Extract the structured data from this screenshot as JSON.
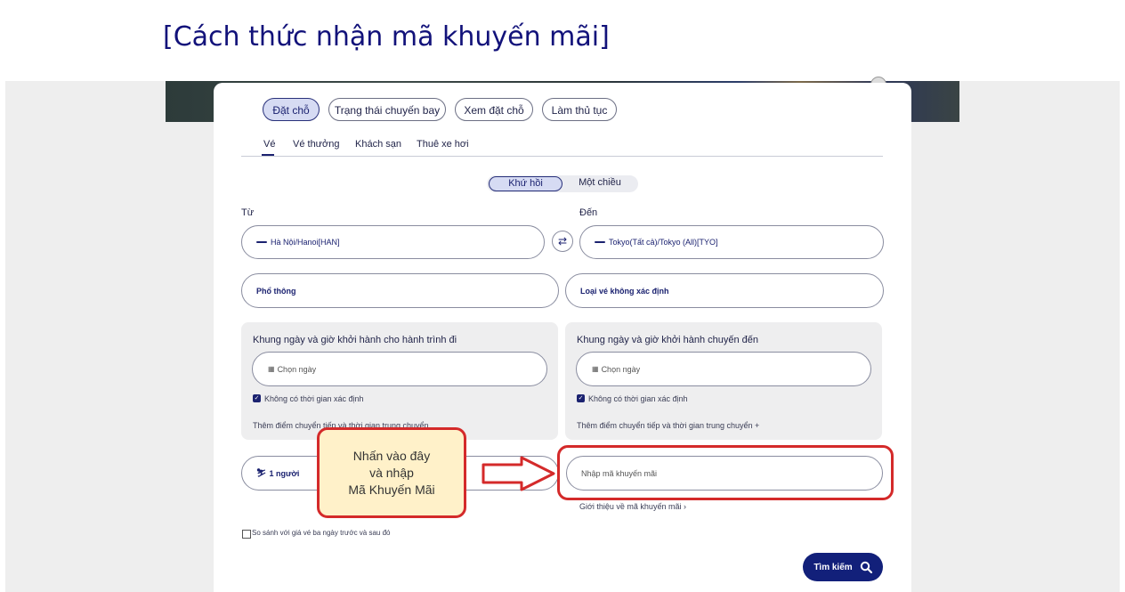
{
  "page_title": "[Cách thức nhận mã khuyến mãi]",
  "top_tabs": [
    {
      "label": "Đặt chỗ",
      "active": true
    },
    {
      "label": "Trạng thái chuyến bay",
      "active": false
    },
    {
      "label": "Xem đặt chỗ",
      "active": false
    },
    {
      "label": "Làm thủ tục",
      "active": false
    }
  ],
  "sub_tabs": [
    {
      "label": "Vé",
      "active": true
    },
    {
      "label": "Vé thưởng",
      "active": false
    },
    {
      "label": "Khách sạn",
      "active": false
    },
    {
      "label": "Thuê xe hơi",
      "active": false
    }
  ],
  "trip_type": {
    "selected": "Khứ hồi",
    "other": "Một chiều"
  },
  "from": {
    "label": "Từ",
    "value": "Hà Nội/Hanoi[HAN]"
  },
  "to": {
    "label": "Đến",
    "value": "Tokyo(Tất cả)/Tokyo (All)[TYO]"
  },
  "cabin_class": "Phổ thông",
  "fare_type": "Loại vé không xác định",
  "outbound": {
    "title": "Khung ngày và giờ khởi hành cho hành trình đi",
    "date_placeholder": "Chọn ngày",
    "no_time_label": "Không có thời gian xác định",
    "add_stopover": "Thêm điểm chuyển tiếp và thời gian trung chuyển"
  },
  "inbound": {
    "title": "Khung ngày và giờ khởi hành chuyến đến",
    "date_placeholder": "Chọn ngày",
    "no_time_label": "Không có thời gian xác định",
    "add_stopover": "Thêm điểm chuyển tiếp và thời gian trung chuyển +"
  },
  "passengers": "1 người",
  "promo": {
    "placeholder": "Nhập mã khuyến mãi",
    "intro_link": "Giới thiệu về mã khuyến mãi"
  },
  "compare_label": "So sánh với giá vé ba ngày trước và sau đó",
  "search_button": "Tìm kiếm",
  "callout": {
    "line1": "Nhấn vào đây",
    "line2": "và nhập",
    "line3": "Mã Khuyến Mãi"
  },
  "colors": {
    "accent": "#12207a",
    "annotation_red": "#d42a2a",
    "callout_fill": "#fff1c9"
  }
}
